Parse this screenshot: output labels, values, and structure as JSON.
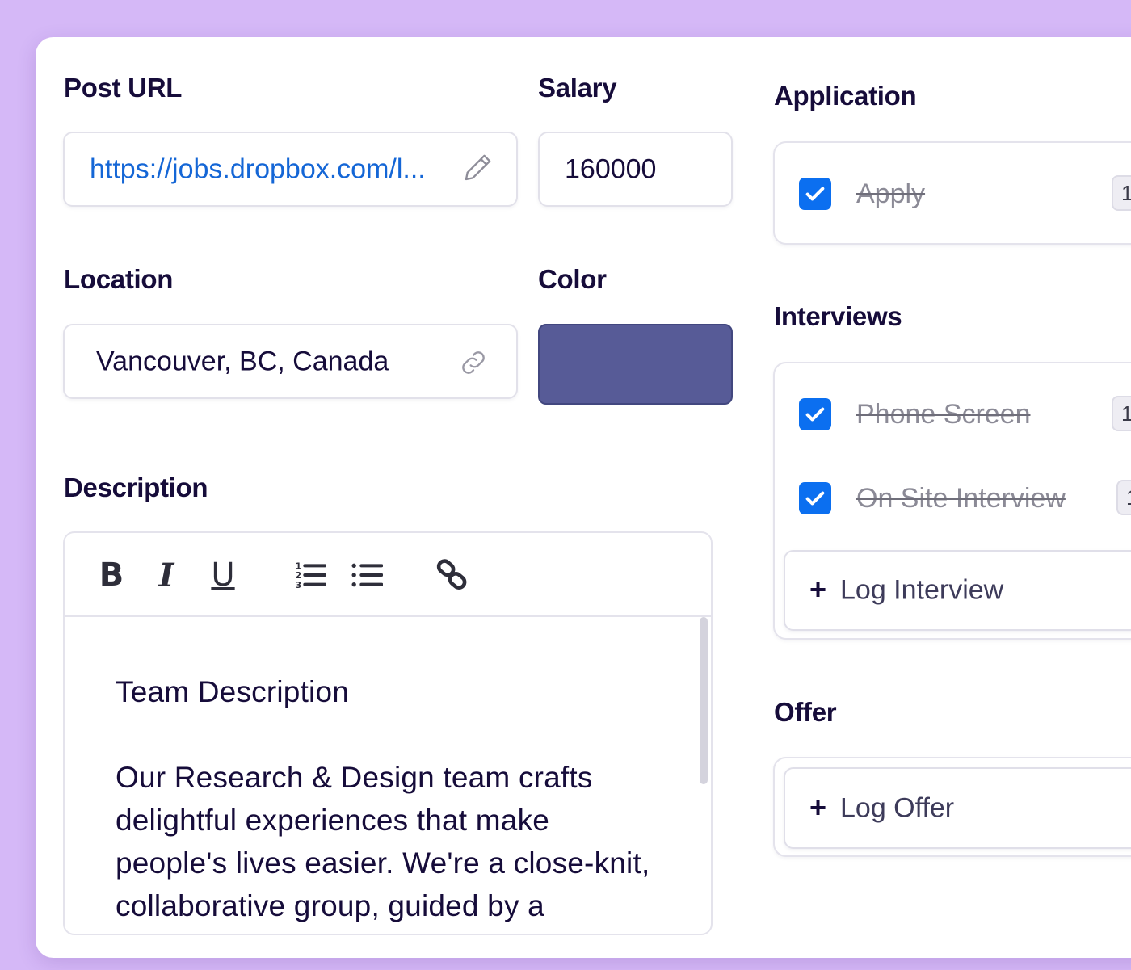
{
  "form": {
    "post_url": {
      "label": "Post URL",
      "value": "https://jobs.dropbox.com/l..."
    },
    "salary": {
      "label": "Salary",
      "value": "160000"
    },
    "location": {
      "label": "Location",
      "value": "Vancouver, BC, Canada"
    },
    "color": {
      "label": "Color",
      "value": "#575b97"
    },
    "description": {
      "label": "Description",
      "toolbar": {
        "bold": "B",
        "italic": "I",
        "underline": "U"
      },
      "heading": "Team Description",
      "body": "Our Research & Design team crafts delightful experiences that make people's lives easier. We're a close-knit, collaborative group, guided by a"
    }
  },
  "stages": {
    "application": {
      "title": "Application",
      "tasks": [
        {
          "label": "Apply",
          "done": true,
          "badge": "1"
        }
      ]
    },
    "interviews": {
      "title": "Interviews",
      "tasks": [
        {
          "label": "Phone Screen",
          "done": true,
          "badge": "1"
        },
        {
          "label": "On Site Interview",
          "done": true,
          "badge": "1"
        }
      ],
      "add_button": {
        "plus": "+",
        "label": "Log Interview"
      }
    },
    "offer": {
      "title": "Offer",
      "add_button": {
        "plus": "+",
        "label": "Log Offer"
      }
    }
  },
  "icons": {
    "url_field": "pencil-icon",
    "location_field": "link-icon",
    "check": "checkmark-icon"
  },
  "colors": {
    "accent": "#0b6ff0",
    "background": "#d5b8f7",
    "link": "#1466d6"
  }
}
